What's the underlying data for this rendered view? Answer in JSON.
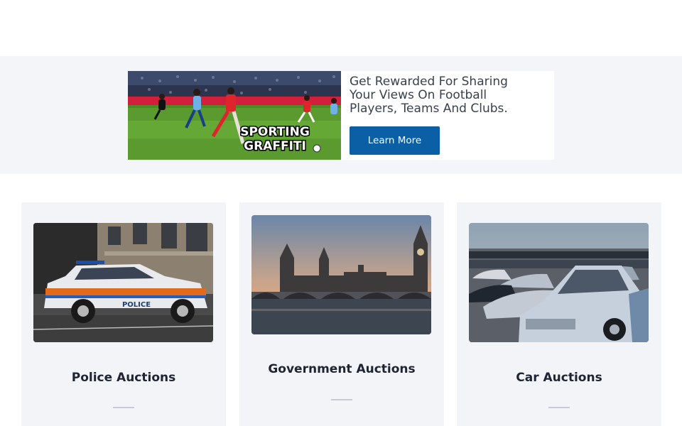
{
  "ad": {
    "image_text": "SPORTING GRAFFITI",
    "image_text_line1": "SPORTING",
    "image_text_line2": "GRAFFITI",
    "headline": "Get Rewarded For Sharing Your Views On Football Players, Teams And Clubs.",
    "button_label": "Learn More",
    "button_color": "#0b5fa5"
  },
  "cards": [
    {
      "title": "Police Auctions",
      "image": "police-car-photo",
      "image_text": "POLICE"
    },
    {
      "title": "Government Auctions",
      "image": "westminster-photo"
    },
    {
      "title": "Car Auctions",
      "image": "car-lot-photo"
    }
  ],
  "colors": {
    "band_background": "#f4f5f9",
    "card_background": "#f3f4f8",
    "title_color": "#1f2433"
  }
}
